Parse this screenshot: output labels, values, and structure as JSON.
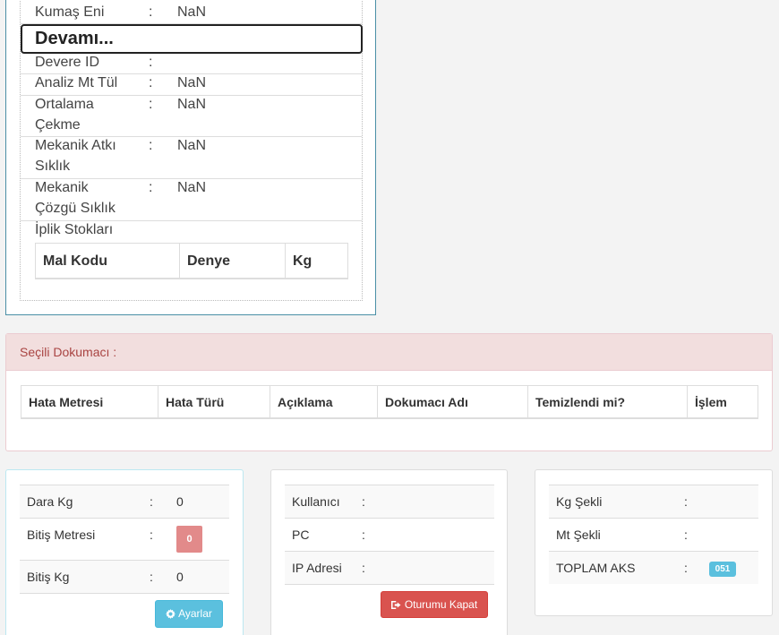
{
  "detail": {
    "kumas_eni": {
      "label": "Kumaş Eni",
      "sep": ":",
      "value": "NaN"
    },
    "devami": "Devamı...",
    "devere_id": {
      "label": "Devere ID",
      "sep": ":",
      "value": ""
    },
    "analiz_mt_tul": {
      "label": "Analiz Mt Tül",
      "sep": ":",
      "value": "NaN"
    },
    "ortalama_cekme": {
      "label_line1": "Ortalama",
      "label_line2": "Çekme",
      "sep": ":",
      "value": "NaN"
    },
    "mekanik_atki": {
      "label_line1": "Mekanik Atkı",
      "label_line2": "Sıklık",
      "sep": ":",
      "value": "NaN"
    },
    "mekanik_cozgu": {
      "label_line1": "Mekanik",
      "label_line2": "Çözgü Sıklık",
      "sep": ":",
      "value": "NaN"
    },
    "iplik_stoklari": "İplik Stokları",
    "stock_columns": [
      "Mal Kodu",
      "Denye",
      "Kg"
    ]
  },
  "dokumaci": {
    "title": "Seçili Dokumacı :",
    "columns": [
      "Hata Metresi",
      "Hata Türü",
      "Açıklama",
      "Dokumacı Adı",
      "Temizlendi mi?",
      "İşlem"
    ]
  },
  "panel_weights": {
    "dara_kg": {
      "label": "Dara Kg",
      "sep": ":",
      "value": "0"
    },
    "bitis_metresi": {
      "label": "Bitiş Metresi",
      "sep": ":",
      "badge": "0"
    },
    "bitis_kg": {
      "label": "Bitiş Kg",
      "sep": ":",
      "value": "0"
    },
    "settings_button": "Ayarlar"
  },
  "panel_user": {
    "kullanici": {
      "label": "Kullanıcı",
      "sep": ":",
      "value": ""
    },
    "pc": {
      "label": "PC",
      "sep": ":",
      "value": ""
    },
    "ip": {
      "label": "IP Adresi",
      "sep": ":",
      "value": ""
    },
    "logout_button": "Oturumu Kapat"
  },
  "panel_shape": {
    "kg_sekli": {
      "label": "Kg Şekli",
      "sep": ":",
      "value": ""
    },
    "mt_sekli": {
      "label": "Mt Şekli",
      "sep": ":",
      "value": ""
    },
    "toplam_aks": {
      "label": "TOPLAM AKS",
      "sep": ":",
      "badge": "051"
    }
  },
  "colors": {
    "danger_header_bg": "#f2dede",
    "danger_header_text": "#a94442",
    "info": "#5bc0de",
    "danger": "#d9534f",
    "badge_red": "#e28a8a"
  },
  "icons": {
    "settings": "gear-icon",
    "logout": "sign-out-icon"
  }
}
